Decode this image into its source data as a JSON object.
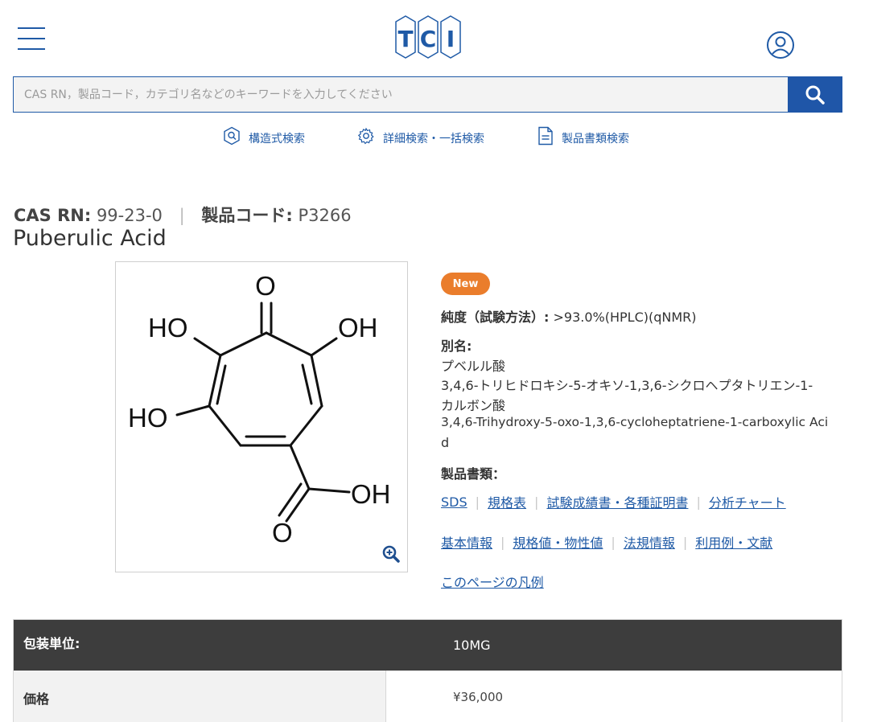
{
  "header": {
    "logo_text": "TCI"
  },
  "search": {
    "placeholder": "CAS RN，製品コード，カテゴリ名などのキーワードを入力してください"
  },
  "subnav": [
    {
      "label": "構造式検索"
    },
    {
      "label": "詳細検索・一括検索"
    },
    {
      "label": "製品書類検索"
    }
  ],
  "product": {
    "cas_label": "CAS RN:",
    "cas_value": "99-23-0",
    "code_label": "製品コード:",
    "code_value": "P3266",
    "name": "Puberulic Acid",
    "badge": "New",
    "purity_label": "純度（試験方法）:",
    "purity_value": ">93.0%(HPLC)(qNMR)",
    "alias_label": "別名:",
    "aliases": [
      "プベルル酸",
      "3,4,6-トリヒドロキシ-5-オキソ-1,3,6-シクロヘプタトリエン-1-",
      "カルボン酸",
      "3,4,6-Trihydroxy-5-oxo-1,3,6-cycloheptatriene-1-carboxylic Aci",
      "d"
    ],
    "docs_label": "製品書類："
  },
  "structure_labels": {
    "o_top": "O",
    "ho_left": "HO",
    "oh_right": "OH",
    "ho_mid": "HO",
    "oh_acid": "OH",
    "o_acid": "O"
  },
  "doc_links": [
    "SDS",
    "規格表",
    "試験成績書・各種証明書",
    "分析チャート"
  ],
  "info_links": [
    "基本情報",
    "規格値・物性値",
    "法規情報",
    "利用例・文献"
  ],
  "legend_link": "このページの凡例",
  "table": {
    "header_label": "包装単位:",
    "header_value": "10MG",
    "price_label": "価格",
    "price_value": "¥36,000"
  },
  "colors": {
    "brand_blue": "#1f5aa6",
    "badge_orange": "#ea7d2c",
    "table_header": "#3d3d3d"
  }
}
